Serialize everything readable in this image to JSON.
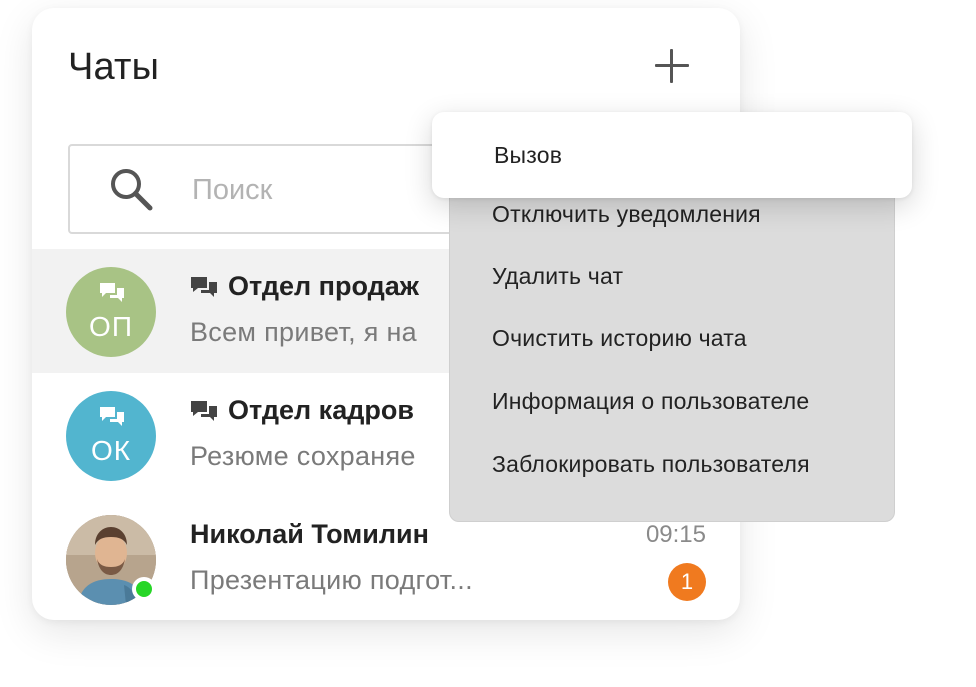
{
  "header": {
    "title": "Чаты",
    "add_icon": "plus-icon"
  },
  "search": {
    "placeholder": "Поиск",
    "value": "",
    "icon": "search-icon"
  },
  "chats": [
    {
      "name": "Отдел продаж",
      "preview": "Всем привет, я на",
      "initials": "ОП",
      "avatar_color": "#a8c385",
      "group": true,
      "active": true
    },
    {
      "name": "Отдел кадров",
      "preview": "Резюме сохраняе",
      "initials": "ОК",
      "avatar_color": "#52b5cf",
      "group": true,
      "active": false
    },
    {
      "name": "Николай Томилин",
      "preview": "Презентацию подгот...",
      "time": "09:15",
      "unread": "1",
      "online": true,
      "active": false
    }
  ],
  "context_menu": {
    "items": [
      {
        "label": "Вызов",
        "highlighted": true
      },
      {
        "label": "Отключить уведомления"
      },
      {
        "label": "Удалить чат"
      },
      {
        "label": "Очистить историю чата"
      },
      {
        "label": "Информация о пользователе"
      },
      {
        "label": "Заблокировать пользователя"
      }
    ]
  },
  "colors": {
    "unread_badge": "#f07a1f",
    "online": "#27d627",
    "menu_bg": "#dcdcdc"
  }
}
